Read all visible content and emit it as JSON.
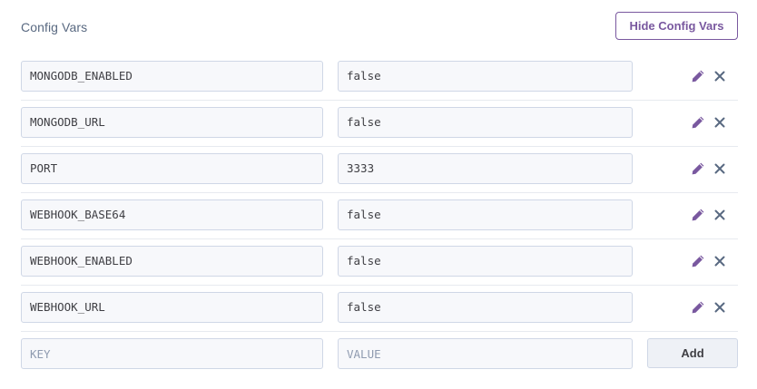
{
  "config_vars": {
    "title": "Config Vars",
    "hide_label": "Hide Config Vars",
    "rows": [
      {
        "key": "MONGODB_ENABLED",
        "value": "false"
      },
      {
        "key": "MONGODB_URL",
        "value": "false"
      },
      {
        "key": "PORT",
        "value": "3333"
      },
      {
        "key": "WEBHOOK_BASE64",
        "value": "false"
      },
      {
        "key": "WEBHOOK_ENABLED",
        "value": "false"
      },
      {
        "key": "WEBHOOK_URL",
        "value": "false"
      }
    ],
    "new_row": {
      "key_placeholder": "KEY",
      "value_placeholder": "VALUE",
      "add_label": "Add"
    }
  },
  "icons": {
    "edit": "pencil-icon",
    "delete": "close-icon"
  },
  "colors": {
    "accent": "#79589f",
    "delete": "#596981",
    "field_border": "#cfd7e6",
    "field_bg": "#f7f8fb",
    "title": "#596981"
  }
}
